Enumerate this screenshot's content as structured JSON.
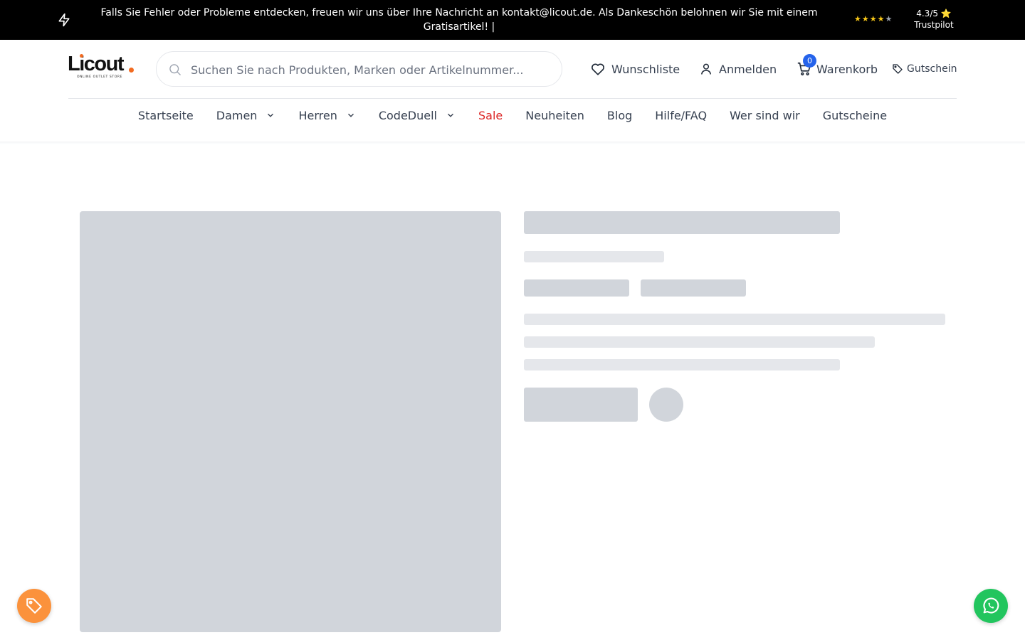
{
  "announcement": {
    "text": "Falls Sie Fehler oder Probleme entdecken, freuen wir uns über Ihre Nachricht an kontakt@licout.de. Als Dankeschön belohnen wir Sie mit einem Gratisartikel! |",
    "icon": "bolt-icon"
  },
  "trustpilot": {
    "stars_filled": 4,
    "stars_total": 5,
    "rating": "4.3/5 ⭐",
    "label": "Trustpilot",
    "star_color": "#f5c518"
  },
  "logo": {
    "wordmark": "Licout",
    "tagline": "ONLINE OUTLET STORE",
    "accent": "#f26b21"
  },
  "search": {
    "placeholder": "Suchen Sie nach Produkten, Marken oder Artikelnummer...",
    "value": ""
  },
  "header": {
    "wishlist_label": "Wunschliste",
    "login_label": "Anmelden",
    "cart_label": "Warenkorb",
    "cart_count": "0",
    "voucher_label": "Gutschein",
    "badge_color": "#2563eb"
  },
  "nav": {
    "items": [
      {
        "label": "Startseite"
      },
      {
        "label": "Damen",
        "dropdown": true
      },
      {
        "label": "Herren",
        "dropdown": true
      },
      {
        "label": "CodeDuell",
        "dropdown": true
      },
      {
        "label": "Sale",
        "highlight": "#dc2626"
      },
      {
        "label": "Neuheiten"
      },
      {
        "label": "Blog"
      },
      {
        "label": "Hilfe/FAQ"
      },
      {
        "label": "Wer sind wir"
      },
      {
        "label": "Gutscheine"
      }
    ]
  },
  "floating": {
    "coupon_color": "#fb923c",
    "whatsapp_color": "#22c55e"
  }
}
